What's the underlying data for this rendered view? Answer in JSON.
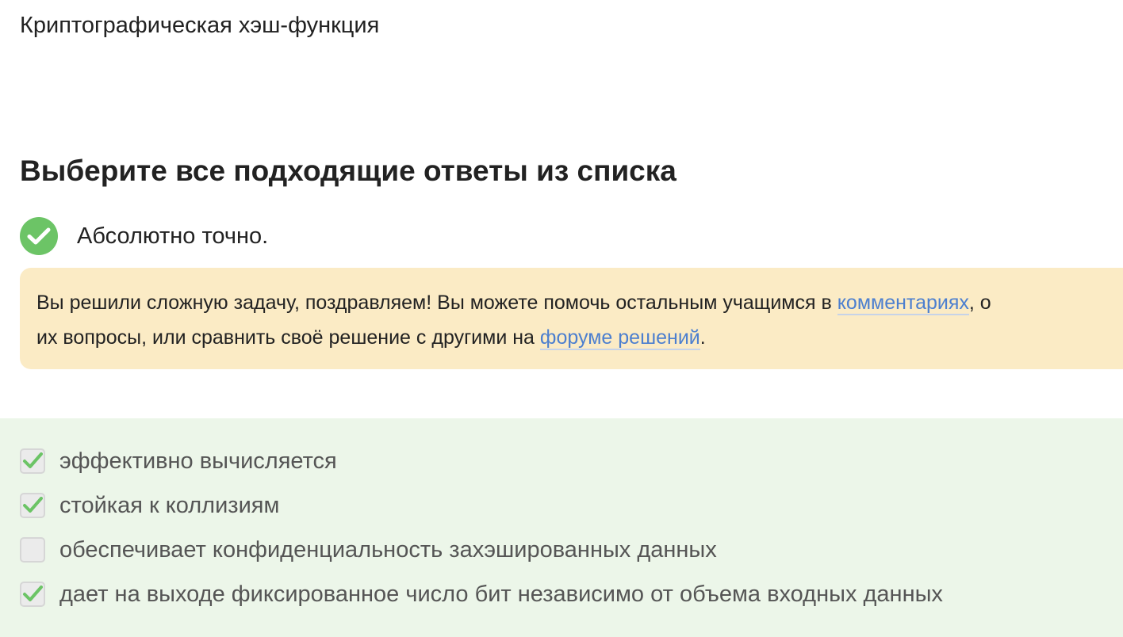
{
  "question": {
    "title": "Криптографическая хэш-функция"
  },
  "task": {
    "heading": "Выберите все подходящие ответы из списка"
  },
  "result": {
    "icon": "check-circle-icon",
    "text": "Абсолютно точно.",
    "color": "#6cc466"
  },
  "hint": {
    "text_before_comments": "Вы решили сложную задачу, поздравляем! Вы можете помочь остальным учащимся в ",
    "comments_link": "комментариях",
    "text_after_comments": ", о",
    "text_line2": "их вопросы, или сравнить своё решение с другими на ",
    "forum_link": "форуме решений",
    "text_end": ".",
    "background": "#fbebc5",
    "link_color": "#4c7fcf"
  },
  "options": [
    {
      "label": "эффективно вычисляется",
      "checked": true
    },
    {
      "label": "стойкая к коллизиям",
      "checked": true
    },
    {
      "label": "обеспечивает конфиденциальность захэшированных данных",
      "checked": false
    },
    {
      "label": "дает на выходе фиксированное число бит независимо от объема входных данных",
      "checked": true
    }
  ],
  "options_area": {
    "background": "#ecf6e9",
    "check_color": "#6cc466"
  }
}
